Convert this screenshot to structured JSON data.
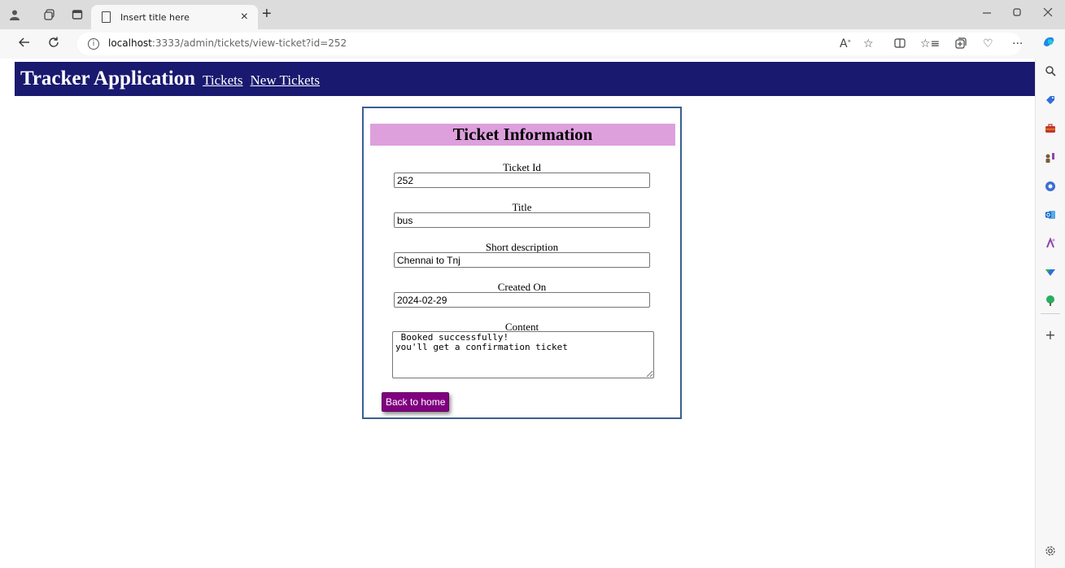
{
  "browser": {
    "tab_title": "Insert title here",
    "tab_close": "×",
    "new_tab": "+",
    "url_host": "localhost",
    "url_path": ":3333/admin/tickets/view-ticket?id=252",
    "info_glyph": "i"
  },
  "navbar": {
    "brand": "Tracker Application",
    "links": [
      "Tickets",
      "New Tickets"
    ]
  },
  "ticket": {
    "heading": "Ticket Information",
    "fields": [
      {
        "label": "Ticket Id",
        "value": "252"
      },
      {
        "label": "Title",
        "value": "bus"
      },
      {
        "label": "Short description",
        "value": "Chennai to Tnj"
      },
      {
        "label": "Created On",
        "value": "2024-02-29"
      }
    ],
    "content_label": "Content",
    "content_value": " Booked successfully!\nyou'll get a confirmation ticket",
    "back_button": "Back to home"
  },
  "colors": {
    "navbar_bg": "#191970",
    "header_bg": "#dda0dd",
    "button_bg": "#800080",
    "card_border": "#3a5f8f"
  },
  "icons": {
    "profile": "profile-icon",
    "workspaces": "workspaces-icon",
    "tab_actions": "tab-actions-icon",
    "back": "back-arrow-icon",
    "refresh": "refresh-icon",
    "read_aloud": "read-aloud-icon",
    "favorite": "star-icon",
    "split_screen": "split-screen-icon",
    "favorites": "favorites-icon",
    "collections": "collections-icon",
    "browser_essentials": "heart-pulse-icon",
    "more": "more-icon",
    "copilot": "copilot-icon",
    "settings": "gear-icon"
  }
}
